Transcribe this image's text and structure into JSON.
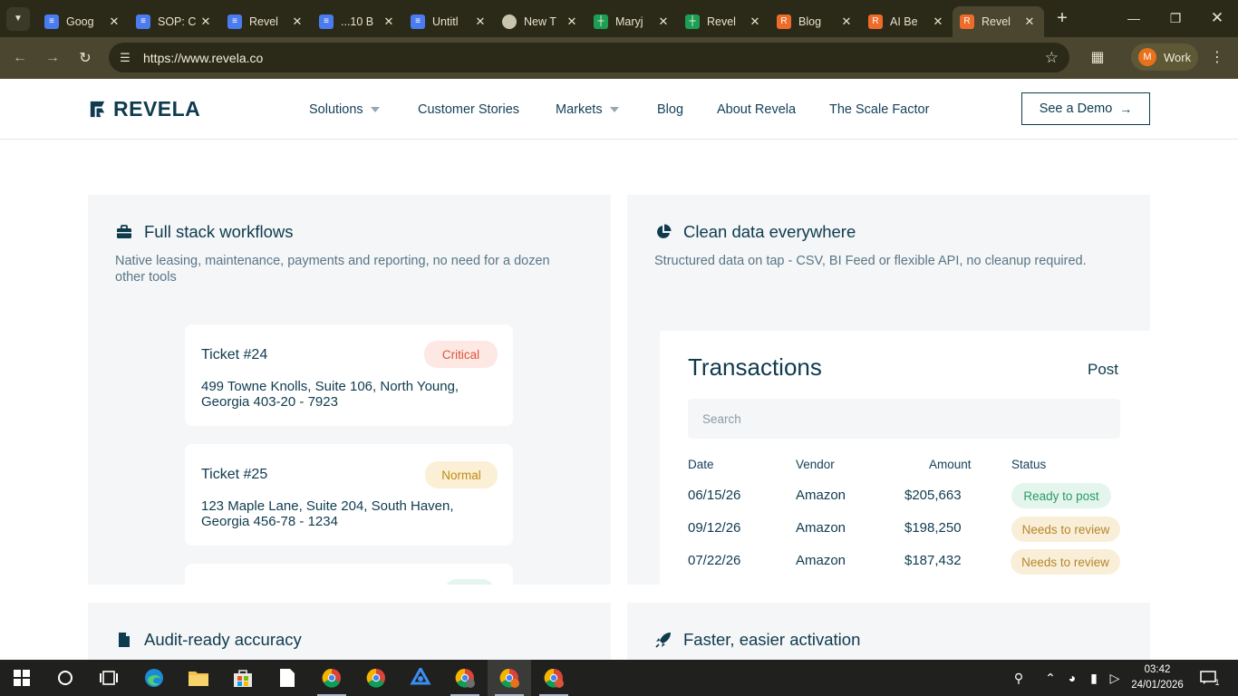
{
  "browser": {
    "tabs": [
      {
        "title": "Goog",
        "favicon": "docs-icon",
        "color": "#4a7cf0"
      },
      {
        "title": "SOP: C",
        "favicon": "docs-icon",
        "color": "#4a7cf0"
      },
      {
        "title": "Revel",
        "favicon": "docs-icon",
        "color": "#4a7cf0"
      },
      {
        "title": "...10 B",
        "favicon": "docs-icon",
        "color": "#4a7cf0"
      },
      {
        "title": "Untitl",
        "favicon": "docs-icon",
        "color": "#4a7cf0"
      },
      {
        "title": "New T",
        "favicon": "chrome-icon",
        "color": "#c9c4ad"
      },
      {
        "title": "Maryj",
        "favicon": "sheets-icon",
        "color": "#1e9e54"
      },
      {
        "title": "Revel",
        "favicon": "sheets-icon",
        "color": "#1e9e54"
      },
      {
        "title": "Blog",
        "favicon": "revela-icon",
        "color": "#ef6b2a"
      },
      {
        "title": "AI Be",
        "favicon": "revela-icon",
        "color": "#ef6b2a"
      },
      {
        "title": "Revel",
        "favicon": "revela-icon",
        "color": "#ef6b2a"
      }
    ],
    "url": "https://www.revela.co",
    "profile_initial": "M",
    "profile_name": "Work"
  },
  "site": {
    "logo_text": "REVELA",
    "nav": [
      {
        "label": "Solutions",
        "dropdown": true
      },
      {
        "label": "Customer Stories",
        "dropdown": false
      },
      {
        "label": "Markets",
        "dropdown": true
      },
      {
        "label": "Blog",
        "dropdown": false
      },
      {
        "label": "About Revela",
        "dropdown": false
      },
      {
        "label": "The Scale Factor",
        "dropdown": false
      }
    ],
    "demo_button": "See a Demo"
  },
  "cards": {
    "workflows": {
      "title": "Full stack workflows",
      "desc": "Native leasing, maintenance, payments and reporting, no need for a dozen other tools",
      "tickets": [
        {
          "name": "Ticket #24",
          "badge": "Critical",
          "address": "499 Towne Knolls, Suite 106, North Young, Georgia 403-20 - 7923"
        },
        {
          "name": "Ticket #25",
          "badge": "Normal",
          "address": "123 Maple Lane, Suite 204, South Haven, Georgia 456-78 - 1234"
        }
      ]
    },
    "clean_data": {
      "title": "Clean data everywhere",
      "desc": "Structured data on tap - CSV, BI Feed or flexible API, no cleanup required.",
      "transactions": {
        "title": "Transactions",
        "action": "Post",
        "search_placeholder": "Search",
        "headers": {
          "date": "Date",
          "vendor": "Vendor",
          "amount": "Amount",
          "status": "Status"
        },
        "rows": [
          {
            "date": "06/15/26",
            "vendor": "Amazon",
            "amount": "$205,663",
            "status": "Ready to post"
          },
          {
            "date": "09/12/26",
            "vendor": "Amazon",
            "amount": "$198,250",
            "status": "Needs to review"
          },
          {
            "date": "07/22/26",
            "vendor": "Amazon",
            "amount": "$187,432",
            "status": "Needs to review"
          }
        ]
      }
    },
    "audit": {
      "title": "Audit-ready accuracy"
    },
    "activation": {
      "title": "Faster, easier activation"
    }
  },
  "colors": {
    "critical_bg": "#fde8e4",
    "critical_fg": "#d9553a",
    "normal_bg": "#fbf0d6",
    "normal_fg": "#c08a12",
    "ready_bg": "#e3f5ec",
    "ready_fg": "#2b9a68",
    "review_bg": "#f9efd9",
    "review_fg": "#b5862a"
  },
  "taskbar": {
    "time": "03:42",
    "date": "24/01/2026",
    "notification_count": "1"
  }
}
